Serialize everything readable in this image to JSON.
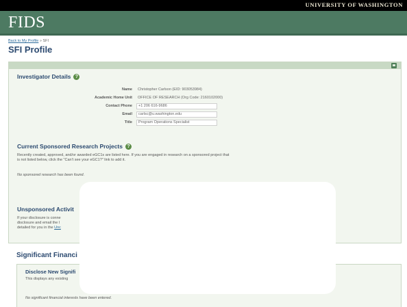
{
  "header": {
    "institution": "UNIVERSITY OF WASHINGTON",
    "app_name": "FIDS"
  },
  "breadcrumb": {
    "back_link": "Back to My Profile",
    "separator": "»",
    "current": "SFI"
  },
  "page": {
    "title": "SFI Profile"
  },
  "panel": {
    "print_icon": "print-icon"
  },
  "investigator": {
    "title": "Investigator Details",
    "help_icon": "?",
    "name_label": "Name",
    "name_value": "Christopher Carlson (EID: 903053984)",
    "unit_label": "Academic Home Unit",
    "unit_value": "OFFICE OF RESEARCH (Org Code: 2160102000)",
    "phone_label": "Contact Phone",
    "phone_value": "+1 206 616-9686",
    "email_label": "Email",
    "email_value": "carlsc@u.washington.edu",
    "title_label": "Title",
    "title_value": "Program Operations Specialist"
  },
  "projects": {
    "title": "Current Sponsored Research Projects",
    "help_icon": "?",
    "desc_line1": "Recently created, approved, and/or awarded eGC1s are listed here. If you are engaged in research on a sponsored project that",
    "desc_line2": "is not listed below, click the \"Can't see your eGC1?\" link to add it.",
    "empty": "No sponsored research has been found."
  },
  "unsponsored": {
    "title": "Unsponsored Activit",
    "line1": "If your disclosure is conne",
    "line2": "disclosure and email the l",
    "line3_pre": "detailed for you in the ",
    "line3_link": "Unc"
  },
  "significant": {
    "title": "Significant Financi",
    "disclose_title": "Disclose New Signifi",
    "disclose_desc": "This displays any existing",
    "empty": "No significant financial interests have been entered."
  }
}
